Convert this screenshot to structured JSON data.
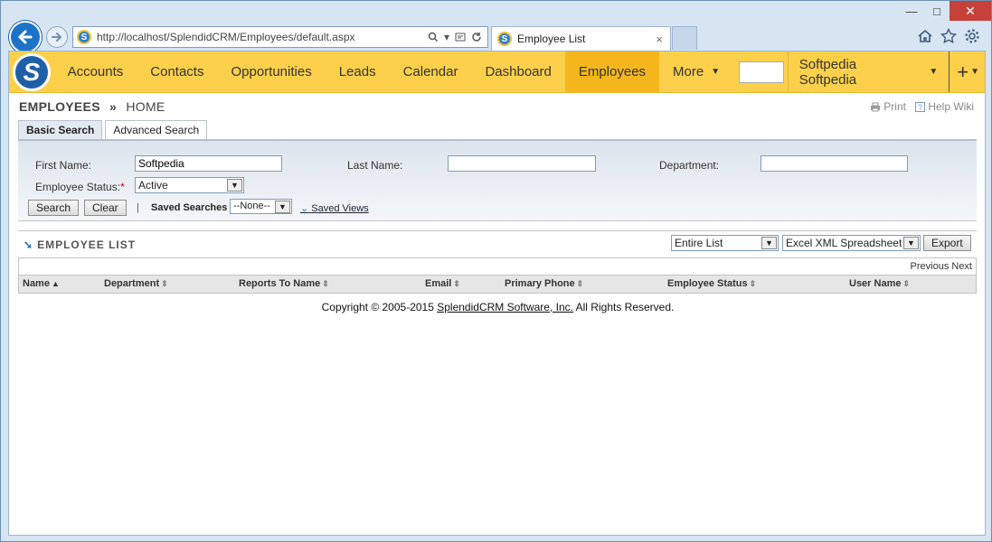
{
  "browser": {
    "url": "http://localhost/SplendidCRM/Employees/default.aspx",
    "tab_title": "Employee List",
    "tab_close": "×",
    "window_minimize": "—",
    "window_maximize": "□",
    "window_close": "✕"
  },
  "nav": {
    "items": [
      "Accounts",
      "Contacts",
      "Opportunities",
      "Leads",
      "Calendar",
      "Dashboard",
      "Employees"
    ],
    "active": "Employees",
    "more_label": "More",
    "user_label": "Softpedia Softpedia",
    "plus_label": "+"
  },
  "breadcrumb": {
    "module": "EMPLOYEES",
    "separator": "»",
    "page": "HOME"
  },
  "top_links": {
    "print": "Print",
    "help": "Help Wiki"
  },
  "search_tabs": [
    "Basic Search",
    "Advanced Search"
  ],
  "search": {
    "first_name_label": "First Name:",
    "first_name_value": "Softpedia",
    "last_name_label": "Last Name:",
    "last_name_value": "",
    "department_label": "Department:",
    "department_value": "",
    "status_label": "Employee Status:",
    "status_required": "*",
    "status_value": "Active",
    "search_button": "Search",
    "clear_button": "Clear",
    "divider": "|",
    "saved_searches_label": "Saved Searches",
    "saved_searches_value": "--None--",
    "saved_views_label": "Saved Views"
  },
  "list": {
    "title": "EMPLOYEE LIST",
    "scope_value": "Entire List",
    "format_value": "Excel XML Spreadsheet",
    "export_button": "Export",
    "pager_text": "Previous Next",
    "columns": [
      "Name",
      "Department",
      "Reports To Name",
      "Email",
      "Primary Phone",
      "Employee Status",
      "User Name"
    ]
  },
  "footer": {
    "prefix": "Copyright © 2005-2015 ",
    "link": "SplendidCRM Software, Inc.",
    "suffix": " All Rights Reserved."
  },
  "colors": {
    "nav_bg": "#fcd04b",
    "nav_active": "#f4b61c",
    "brand_blue": "#1f5fa8"
  }
}
